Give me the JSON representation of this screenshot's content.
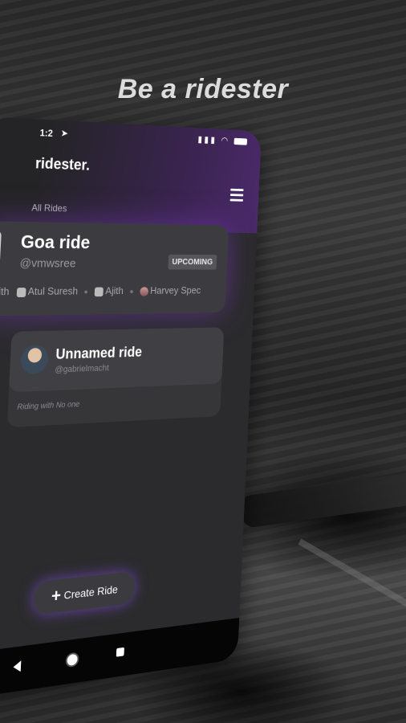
{
  "headline": "Be a ridester",
  "status_bar": {
    "time": "1:2",
    "location_glyph": "➤",
    "icons": "▮▮▮ ◠"
  },
  "app": {
    "brand": "ridester.",
    "section_label": "All Rides"
  },
  "rides": [
    {
      "title": "Goa ride",
      "handle": "@vmwsree",
      "badge": "UPCOMING",
      "riding_label": "g with",
      "riders": [
        "Atul Suresh",
        "Ajith",
        "Harvey Spec"
      ]
    },
    {
      "title": "Unnamed ride",
      "handle": "@gabrielmacht",
      "riding_text": "Riding with   No one"
    }
  ],
  "create_button": {
    "label": "Create Ride",
    "icon": "plus-icon"
  },
  "colors": {
    "accent": "#7a3fc0",
    "card": "#3c3c40",
    "background": "#2b2b2d"
  }
}
